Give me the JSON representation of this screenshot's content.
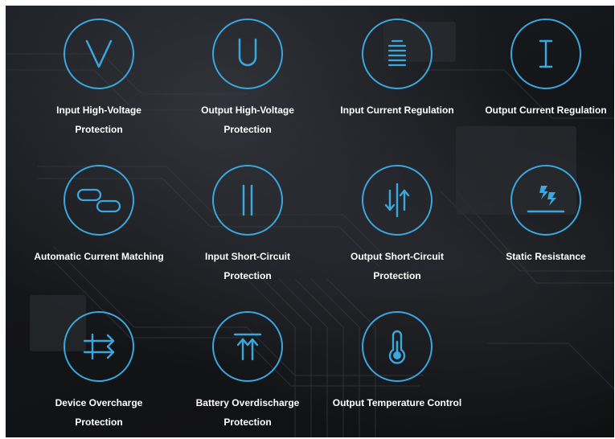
{
  "accent_color": "#3aa7de",
  "features": [
    {
      "label": "Input High-Voltage\nProtection",
      "icon": "v-letter-icon"
    },
    {
      "label": "Output High-Voltage\nProtection",
      "icon": "u-letter-icon"
    },
    {
      "label": "Input Current Regulation",
      "icon": "stacked-lines-icon"
    },
    {
      "label": "Output Current Regulation",
      "icon": "i-beam-icon"
    },
    {
      "label": "Automatic Current Matching",
      "icon": "linked-pills-icon"
    },
    {
      "label": "Input Short-Circuit\nProtection",
      "icon": "parallel-bars-icon"
    },
    {
      "label": "Output Short-Circuit\nProtection",
      "icon": "split-arrows-icon"
    },
    {
      "label": "Static Resistance",
      "icon": "lightning-ground-icon"
    },
    {
      "label": "Device Overcharge\nProtection",
      "icon": "blocked-arrows-icon"
    },
    {
      "label": "Battery Overdischarge\nProtection",
      "icon": "up-arrows-bar-icon"
    },
    {
      "label": "Output Temperature Control",
      "icon": "thermometer-icon"
    }
  ]
}
